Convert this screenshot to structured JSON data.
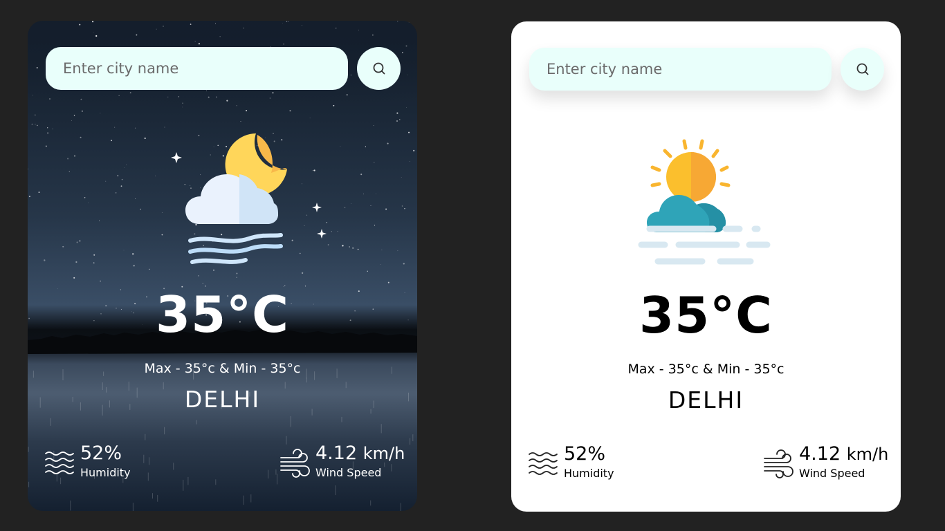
{
  "cards": [
    {
      "theme": "night",
      "search": {
        "placeholder": "Enter city name"
      },
      "weather_icon": "cloudy-night-fog-icon",
      "temperature": "35°C",
      "minmax": "Max - 35°c & Min - 35°c",
      "city": "DELHI",
      "humidity": {
        "value": "52%",
        "label": "Humidity",
        "icon": "waves-icon"
      },
      "wind": {
        "value": "4.12",
        "unit": "km/h",
        "label": "Wind Speed",
        "icon": "wind-icon"
      }
    },
    {
      "theme": "day",
      "search": {
        "placeholder": "Enter city name"
      },
      "weather_icon": "partly-sunny-fog-icon",
      "temperature": "35°C",
      "minmax": "Max - 35°c & Min - 35°c",
      "city": "DELHI",
      "humidity": {
        "value": "52%",
        "label": "Humidity",
        "icon": "waves-icon"
      },
      "wind": {
        "value": "4.12",
        "unit": "km/h",
        "label": "Wind Speed",
        "icon": "wind-icon"
      }
    }
  ],
  "colors": {
    "page_background": "#222222",
    "search_background": "#e9fffb",
    "day_card_background": "#ffffff"
  }
}
